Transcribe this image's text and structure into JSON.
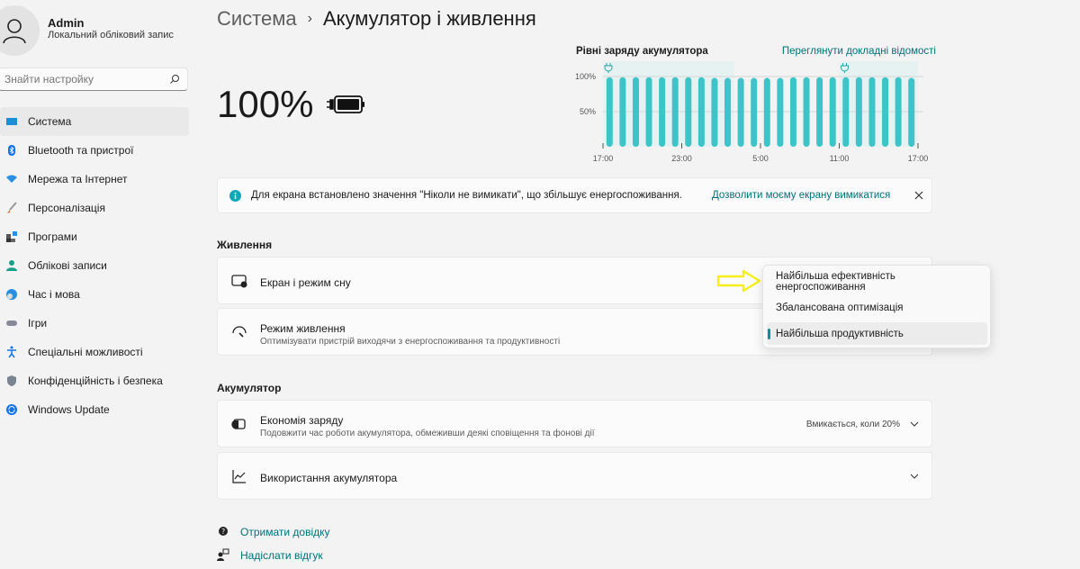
{
  "user": {
    "name": "Admin",
    "subtitle": "Локальний обліковий запис"
  },
  "search": {
    "placeholder": "Знайти настройку"
  },
  "sidebar": {
    "items": [
      {
        "label": "Система",
        "icon": "monitor-icon",
        "selected": true
      },
      {
        "label": "Bluetooth та пристрої",
        "icon": "bluetooth-icon"
      },
      {
        "label": "Мережа та Інтернет",
        "icon": "wifi-icon"
      },
      {
        "label": "Персоналізація",
        "icon": "brush-icon"
      },
      {
        "label": "Програми",
        "icon": "apps-icon"
      },
      {
        "label": "Облікові записи",
        "icon": "person-icon"
      },
      {
        "label": "Час і мова",
        "icon": "clock-globe-icon"
      },
      {
        "label": "Ігри",
        "icon": "gamepad-icon"
      },
      {
        "label": "Спеціальні можливості",
        "icon": "accessibility-icon"
      },
      {
        "label": "Конфіденційність і безпека",
        "icon": "shield-icon"
      },
      {
        "label": "Windows Update",
        "icon": "update-icon"
      }
    ]
  },
  "breadcrumb": {
    "parent": "Система",
    "separator": "›",
    "current": "Акумулятор і живлення"
  },
  "battery": {
    "percent": "100%",
    "icon": "battery-charging-icon"
  },
  "chart_data": {
    "type": "bar",
    "title": "Рівні заряду акумулятора",
    "link": "Переглянути докладні відомості",
    "x_ticks": [
      "17:00",
      "23:00",
      "5:00",
      "11:00",
      "17:00"
    ],
    "y_ticks": [
      "100%",
      "50%"
    ],
    "ylim": [
      0,
      100
    ],
    "grid": true,
    "values": [
      99,
      99,
      99,
      99,
      99,
      99,
      99,
      99,
      98,
      98,
      98,
      98,
      98,
      98,
      99,
      99,
      99,
      99,
      99,
      99,
      99,
      99,
      99,
      98
    ],
    "charging_periods": [
      [
        0,
        10
      ],
      [
        18,
        24
      ]
    ],
    "bar_color": "#3cc4c8",
    "charging_shade_color": "#e6f2f1"
  },
  "notice": {
    "text": "Для екрана встановлено значення \"Ніколи не вимикати\", що збільшує енергоспоживання.",
    "action": "Дозволити моєму екрану вимикатися",
    "icon": "info-icon"
  },
  "power": {
    "heading": "Живлення",
    "screen_sleep": {
      "title": "Екран і режим сну"
    },
    "power_mode": {
      "title": "Режим живлення",
      "subtitle": "Оптимізувати пристрій виходячи з енергоспоживання та продуктивності"
    },
    "dropdown": {
      "options": [
        "Найбільша ефективність енергоспоживання",
        "Збалансована оптимізація",
        "Найбільша продуктивність"
      ],
      "selected": "Найбільша продуктивність"
    }
  },
  "battery_section": {
    "heading": "Акумулятор",
    "saver": {
      "title": "Економія заряду",
      "subtitle": "Подовжити час роботи акумулятора, обмеживши деякі сповіщення та фонові дії",
      "value": "Вмикається, коли 20%"
    },
    "usage": {
      "title": "Використання акумулятора"
    }
  },
  "footer": {
    "help": "Отримати довідку",
    "feedback": "Надіслати відгук"
  },
  "colors": {
    "accent": "#00707b",
    "annotation_arrow": "#f5ef1a"
  }
}
